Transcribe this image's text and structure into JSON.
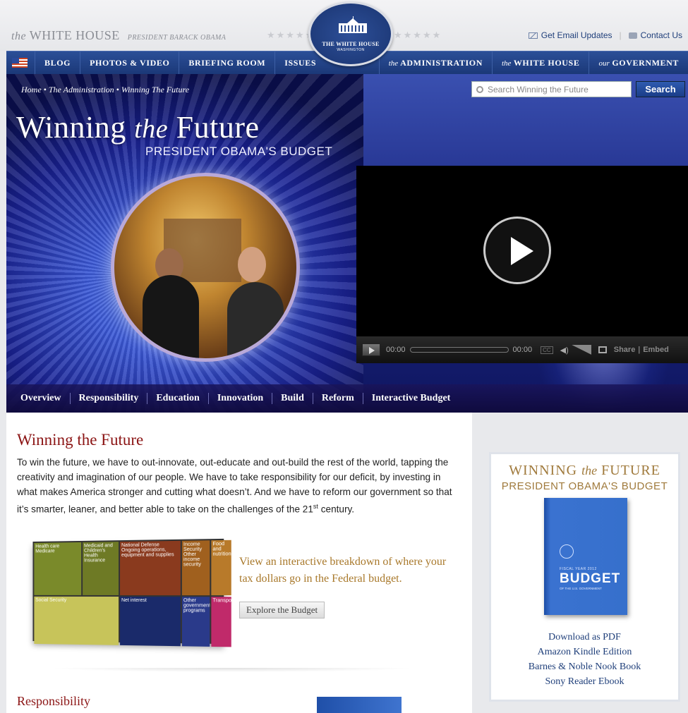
{
  "header": {
    "brand_the": "the",
    "brand_name": "WHITE HOUSE",
    "brand_sub": "PRESIDENT BARACK OBAMA",
    "stars_left": "★★★★★",
    "stars_right": "★★★★★",
    "seal_line1": "THE WHITE HOUSE",
    "seal_line2": "WASHINGTON",
    "email_link": "Get Email Updates",
    "contact_link": "Contact Us"
  },
  "nav": {
    "items": [
      "BLOG",
      "PHOTOS & VIDEO",
      "BRIEFING ROOM",
      "ISSUES"
    ],
    "right": [
      {
        "prefix": "the",
        "label": "ADMINISTRATION"
      },
      {
        "prefix": "the",
        "label": "WHITE HOUSE"
      },
      {
        "prefix": "our",
        "label": "GOVERNMENT"
      }
    ]
  },
  "hero": {
    "breadcrumb": "Home • The Administration • Winning The Future",
    "search_placeholder": "Search Winning the Future",
    "search_button": "Search",
    "title_a": "Winning ",
    "title_b": "the",
    "title_c": " Future",
    "subtitle": "PRESIDENT OBAMA'S BUDGET"
  },
  "player": {
    "time_current": "00:00",
    "time_total": "00:00",
    "cc": "CC",
    "share": "Share",
    "separator": "|",
    "embed": "Embed"
  },
  "subnav": [
    "Overview",
    "Responsibility",
    "Education",
    "Innovation",
    "Build",
    "Reform",
    "Interactive Budget"
  ],
  "main": {
    "heading": "Winning the Future",
    "intro": "To win the future, we have to out-innovate, out-educate and out-build the rest of the world, tapping the creativity and imagination of our people. We have to take responsibility for our deficit, by investing in what makes America stronger and cutting what doesn’t. And we have to reform our government so that it’s smarter, leaner, and better able to take on the challenges of the 21",
    "intro_sup": "st",
    "intro_end": "century.",
    "cta": "View an interactive breakdown of where your tax dollars go in the Federal budget.",
    "explore_button": "Explore the Budget",
    "section2": "Responsibility",
    "treemap": [
      {
        "label": "Health care\nMedicare",
        "color": "#7a8a2a"
      },
      {
        "label": "Medicaid and Children's Health Insurance",
        "color": "#6e7a25"
      },
      {
        "label": "National Defense\nOngoing operations, equipment and supplies",
        "color": "#8a3a1e"
      },
      {
        "label": "Income Security\nOther income security",
        "color": "#a0601e"
      },
      {
        "label": "Food and nutrition",
        "color": "#b87a2a"
      },
      {
        "label": "Social Security",
        "color": "#c7c45a"
      },
      {
        "label": "Net interest",
        "color": "#1a2a6a"
      },
      {
        "label": "Other government programs",
        "color": "#2a3a8a"
      },
      {
        "label": "Transportation",
        "color": "#c02a6a"
      },
      {
        "label": "",
        "color": "#5aa04a"
      }
    ]
  },
  "sidebar": {
    "title_a": "WINNING ",
    "title_b": "the",
    "title_c": " FUTURE",
    "subtitle": "PRESIDENT OBAMA'S BUDGET",
    "book_fy": "FISCAL YEAR 2012",
    "book_title": "BUDGET",
    "book_of": "OF THE U.S. GOVERNMENT",
    "links": [
      "Download as PDF",
      "Amazon Kindle Edition",
      "Barnes & Noble Nook Book",
      "Sony Reader Ebook"
    ]
  }
}
